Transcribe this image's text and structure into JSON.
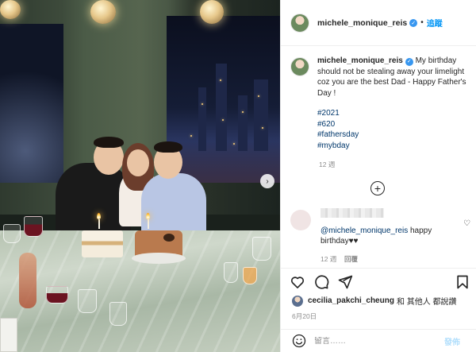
{
  "header": {
    "username": "michele_monique_reis",
    "dot": "•",
    "follow_label": "追蹤"
  },
  "caption": {
    "username": "michele_monique_reis",
    "text": " My birthday should not be stealing away your limelight coz you are the best Dad - Happy Father's Day !",
    "hashtags": [
      "#2021",
      "#620",
      "#fathersday",
      "#mybday"
    ],
    "time": "12 週"
  },
  "comment": {
    "mention": "@michele_monique_reis",
    "text": " happy birthday♥♥",
    "time": "12 週",
    "reply_label": "回覆"
  },
  "likes": {
    "liker": "cecilia_pakchi_cheung",
    "rest": "和 其他人 都說讚"
  },
  "post_date": "6月20日",
  "comment_box": {
    "placeholder": "留言……",
    "post_label": "發佈"
  },
  "icons": {
    "verified": "verified-badge-icon",
    "load_more": "plus-circle-icon",
    "like": "heart-icon",
    "comment": "comment-bubble-icon",
    "share": "paper-plane-icon",
    "save": "bookmark-icon",
    "emoji": "smiley-icon"
  },
  "colors": {
    "accent": "#0095f6",
    "hashtag": "#00376b",
    "muted": "#8e8e8e"
  }
}
